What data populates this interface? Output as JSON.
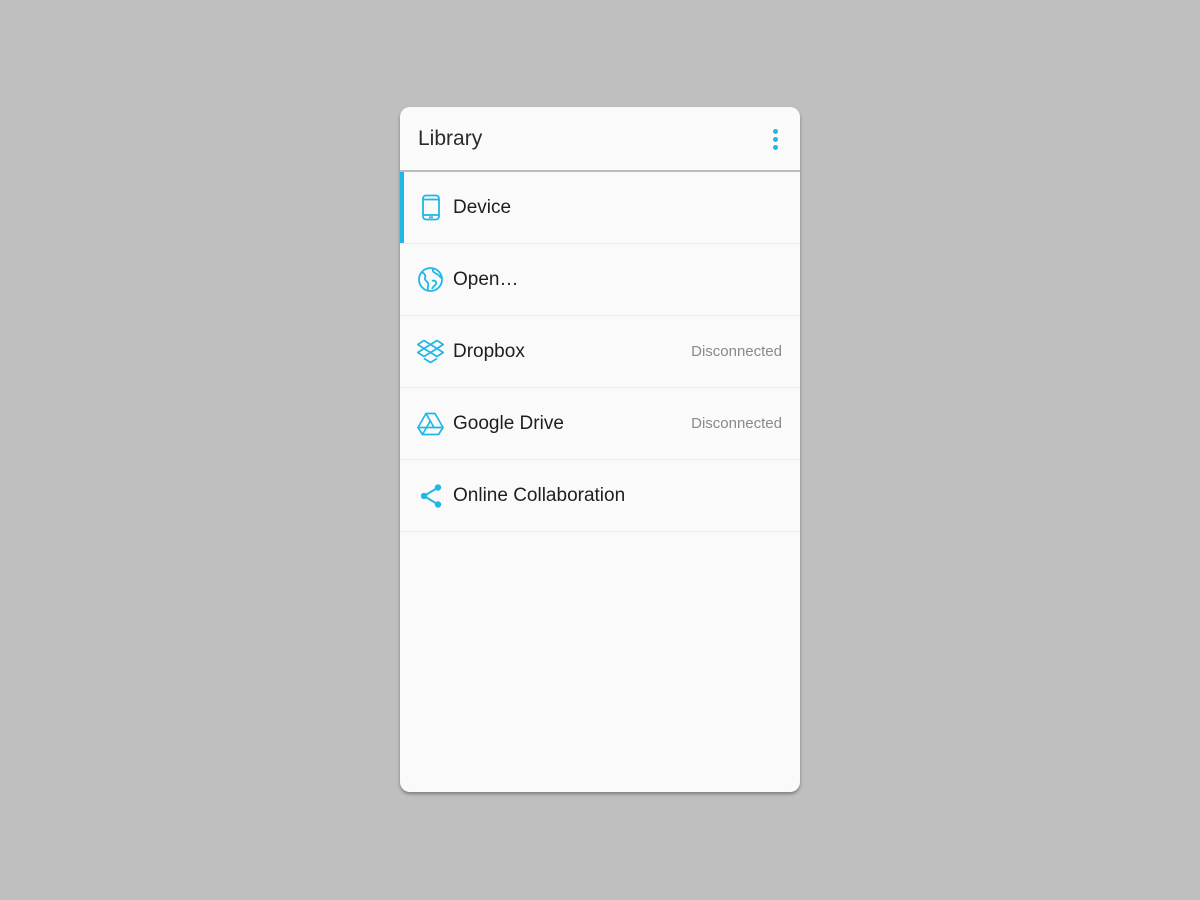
{
  "header": {
    "title": "Library",
    "menu_icon": "more-vertical-icon"
  },
  "colors": {
    "accent": "#1fb8e6",
    "background": "#bfbfbf",
    "panel": "#fafafa"
  },
  "items": [
    {
      "label": "Device",
      "icon": "phone-icon",
      "status": "",
      "active": true
    },
    {
      "label": "Open…",
      "icon": "globe-icon",
      "status": "",
      "active": false
    },
    {
      "label": "Dropbox",
      "icon": "dropbox-icon",
      "status": "Disconnected",
      "active": false
    },
    {
      "label": "Google Drive",
      "icon": "google-drive-icon",
      "status": "Disconnected",
      "active": false
    },
    {
      "label": "Online Collaboration",
      "icon": "share-icon",
      "status": "",
      "active": false
    }
  ]
}
